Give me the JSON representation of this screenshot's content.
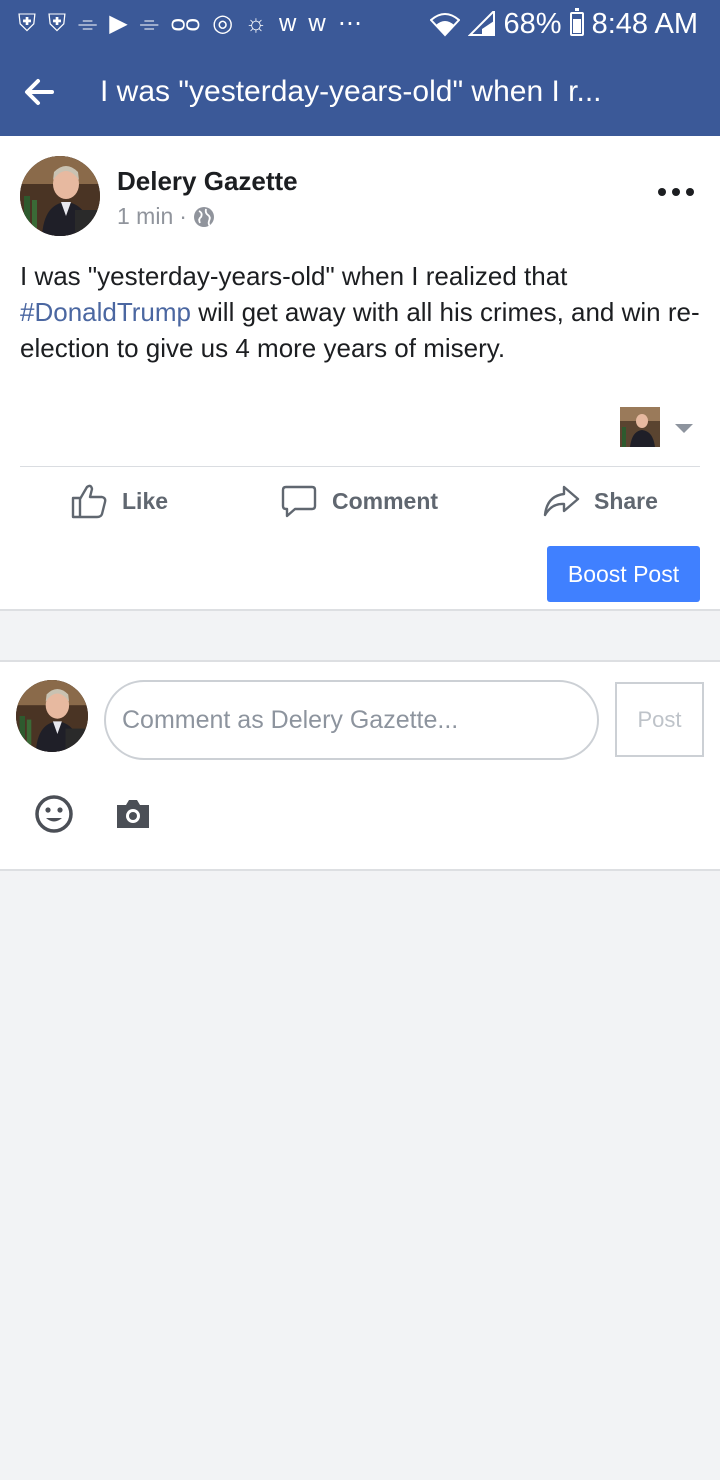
{
  "status_bar": {
    "icons": [
      "shield-icon",
      "shield-icon",
      "cast-icon",
      "youtube-icon",
      "cast-icon",
      "voicemail-icon",
      "instagram-icon",
      "weather-icon",
      "w-icon",
      "w-icon",
      "more-notifications-icon"
    ],
    "icon_glyphs": [
      "⛨",
      "⛨",
      "⌯",
      "▶",
      "⌯",
      "ᴑᴑ",
      "◎",
      "☼",
      "ᴡ",
      "ᴡ",
      "⋯"
    ],
    "battery": "68%",
    "time": "8:48 AM"
  },
  "app_bar": {
    "title": "I was \"yesterday-years-old\" when I r..."
  },
  "post": {
    "author": "Delery Gazette",
    "time": "1 min",
    "separator": "·",
    "text_before": "I was \"yesterday-years-old\" when I realized that ",
    "hashtag": "#DonaldTrump",
    "text_after": " will get away with all his crimes, and win re-election to give us 4 more years of misery.",
    "actions": {
      "like": "Like",
      "comment": "Comment",
      "share": "Share"
    },
    "boost_label": "Boost Post"
  },
  "composer": {
    "placeholder": "Comment as Delery Gazette...",
    "post_label": "Post"
  },
  "colors": {
    "brand": "#3b5998",
    "hashtag": "#4b67a1",
    "boost": "#4080ff"
  }
}
